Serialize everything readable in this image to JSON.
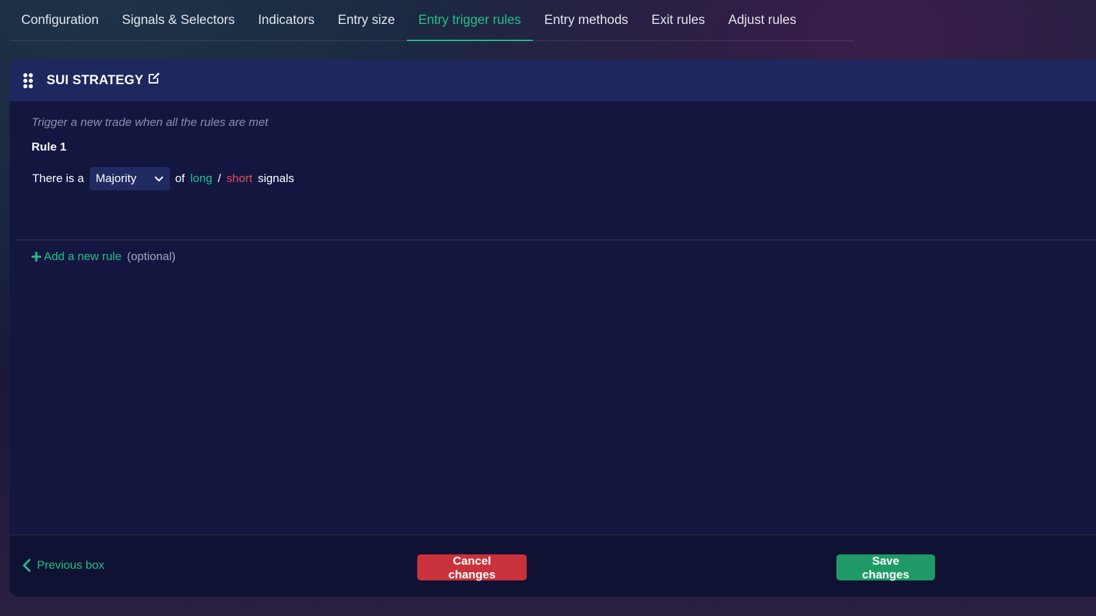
{
  "tabs": [
    {
      "label": "Configuration",
      "active": false
    },
    {
      "label": "Signals & Selectors",
      "active": false
    },
    {
      "label": "Indicators",
      "active": false
    },
    {
      "label": "Entry size",
      "active": false
    },
    {
      "label": "Entry trigger rules",
      "active": true
    },
    {
      "label": "Entry methods",
      "active": false
    },
    {
      "label": "Exit rules",
      "active": false
    },
    {
      "label": "Adjust rules",
      "active": false
    }
  ],
  "panel": {
    "title": "SUI STRATEGY",
    "icons": {
      "drag": "drag-handle-icon",
      "edit": "edit-icon"
    },
    "hint": "Trigger a new trade when all the rules are met",
    "rule": {
      "title": "Rule 1",
      "prefix": "There is a",
      "select_value": "Majority",
      "of": "of",
      "long": "long",
      "slash": "/",
      "short": "short",
      "suffix": "signals"
    },
    "add_rule": {
      "label": "Add a new rule",
      "optional": "(optional)"
    }
  },
  "footer": {
    "previous": "Previous box",
    "cancel": "Cancel changes",
    "save": "Save changes"
  },
  "colors": {
    "accent_green": "#22c08a",
    "danger_red": "#c9323a",
    "save_green": "#1f9a66",
    "header_bg": "#1f275f",
    "panel_bg": "#131740"
  }
}
